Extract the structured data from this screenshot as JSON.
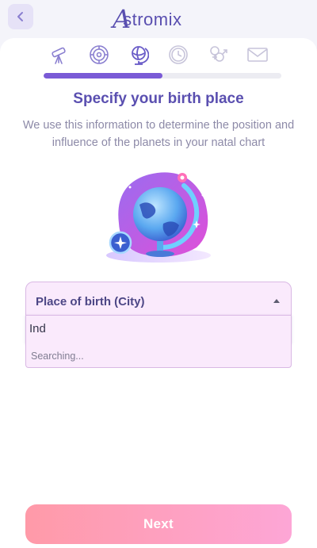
{
  "header": {
    "app_name": "Astromix",
    "back_icon": "chevron-left-icon"
  },
  "steps": {
    "icons": [
      "telescope-icon",
      "zodiac-wheel-icon",
      "globe-icon",
      "clock-icon",
      "gender-icon",
      "envelope-icon"
    ],
    "active_index": 2,
    "progress": 0.5
  },
  "main": {
    "title": "Specify your birth place",
    "subtitle": "We use this information to determine the position and influence of the planets in your natal chart"
  },
  "birth_place": {
    "label": "Place of birth (City)",
    "value": "Ind",
    "status": "Searching..."
  },
  "footer": {
    "next_label": "Next"
  },
  "colors": {
    "brand": "#5a4fb0",
    "progress_fill": "#7a5ad6",
    "field_bg": "#faeafc",
    "button_gradient_start": "#ff9aa8",
    "button_gradient_end": "#fda6d6"
  }
}
